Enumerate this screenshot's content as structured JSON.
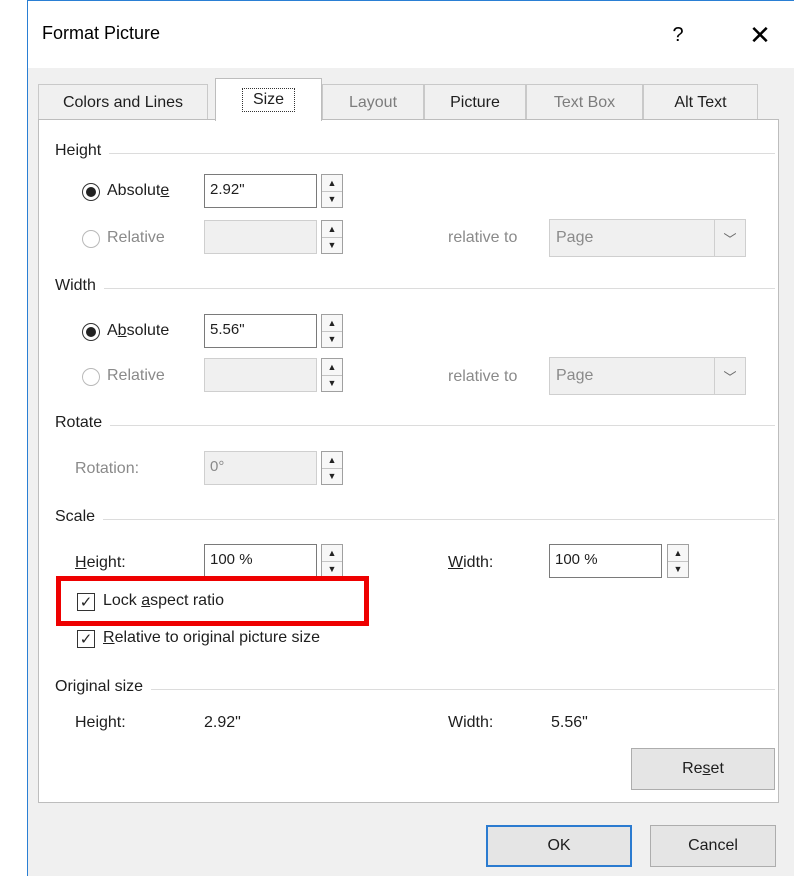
{
  "window": {
    "title": "Format Picture",
    "help_label": "?",
    "close_label": "✕"
  },
  "tabs": [
    {
      "label": "Colors and Lines",
      "state": "normal"
    },
    {
      "label": "Size",
      "state": "active"
    },
    {
      "label": "Layout",
      "state": "disabled"
    },
    {
      "label": "Picture",
      "state": "normal"
    },
    {
      "label": "Text Box",
      "state": "disabled"
    },
    {
      "label": "Alt Text",
      "state": "normal"
    }
  ],
  "height_group": {
    "label": "Height",
    "absolute": {
      "label_pre": "Absolut",
      "label_key": "e",
      "label_post": "",
      "value": "2.92\"",
      "checked": true
    },
    "relative": {
      "label": "Relative",
      "value": "",
      "relative_to_label": "relative to",
      "relative_to_value": "Page"
    }
  },
  "width_group": {
    "label": "Width",
    "absolute": {
      "label_pre": "A",
      "label_key": "b",
      "label_post": "solute",
      "value": "5.56\"",
      "checked": true
    },
    "relative": {
      "label": "Relative",
      "value": "",
      "relative_to_label": "relative to",
      "relative_to_value": "Page"
    }
  },
  "rotate_group": {
    "label": "Rotate",
    "rotation_label": "Rotation:",
    "rotation_value": "0°"
  },
  "scale_group": {
    "label": "Scale",
    "height_label_key": "H",
    "height_label_rest": "eight:",
    "height_value": "100 %",
    "width_label_key": "W",
    "width_label_rest": "idth:",
    "width_value": "100 %",
    "lock_aspect": {
      "label_pre": "Lock ",
      "label_key": "a",
      "label_post": "spect ratio",
      "checked": true
    },
    "relative_original": {
      "label_key": "R",
      "label_rest": "elative to original picture size",
      "checked": true
    }
  },
  "original_size": {
    "label": "Original size",
    "height_label": "Height:",
    "height_value": "2.92\"",
    "width_label": "Width:",
    "width_value": "5.56\""
  },
  "buttons": {
    "reset_pre": "Re",
    "reset_key": "s",
    "reset_post": "et",
    "ok": "OK",
    "cancel": "Cancel"
  },
  "highlight": {
    "color": "#ee0000"
  },
  "icons": {
    "spin_up": "▲",
    "spin_down": "▼",
    "dropdown": "﹀",
    "check": "✓"
  }
}
